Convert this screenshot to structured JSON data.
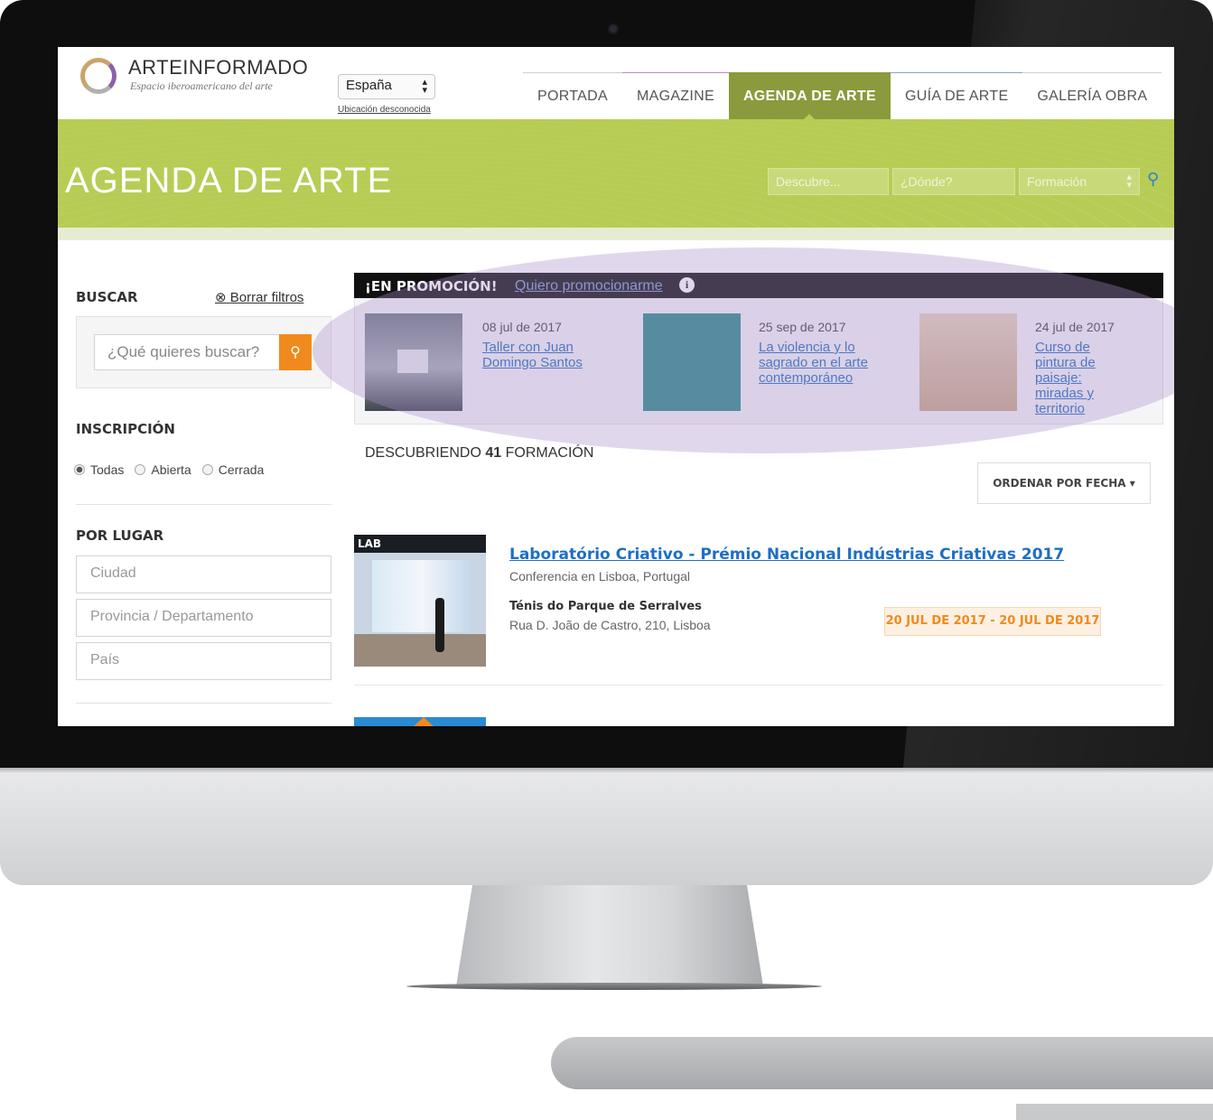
{
  "brand": {
    "name": "ARTEINFORMADO",
    "tagline": "Espacio iberoamericano del arte"
  },
  "location": {
    "country": "España",
    "status_link": "Ubicación desconocida"
  },
  "nav": {
    "items": [
      "PORTADA",
      "MAGAZINE",
      "AGENDA DE ARTE",
      "GUÍA DE ARTE",
      "GALERÍA OBRA"
    ],
    "active": "AGENDA DE ARTE"
  },
  "hero": {
    "title": "AGENDA DE ARTE",
    "discover_placeholder": "Descubre...",
    "where_placeholder": "¿Dónde?",
    "category_value": "Formación"
  },
  "sidebar": {
    "search_heading": "BUSCAR",
    "clear_filters": "Borrar filtros",
    "search_placeholder": "¿Qué quieres buscar?",
    "inscription_heading": "INSCRIPCIÓN",
    "inscription_options": [
      "Todas",
      "Abierta",
      "Cerrada"
    ],
    "inscription_selected": "Todas",
    "place_heading": "POR LUGAR",
    "city_placeholder": "Ciudad",
    "province_placeholder": "Provincia / Departamento",
    "country_placeholder": "País"
  },
  "promo": {
    "title": "¡EN PROMOCIÓN!",
    "link": "Quiero promocionarme",
    "items": [
      {
        "date": "08 jul de 2017",
        "title": "Taller con Juan Domingo Santos"
      },
      {
        "date": "25 sep de 2017",
        "title": "La violencia y lo sagrado en el arte contemporáneo"
      },
      {
        "date": "24 jul de 2017",
        "title": "Curso de pintura de paisaje: miradas y territorio"
      }
    ]
  },
  "results": {
    "prefix": "DESCUBRIENDO",
    "count": "41",
    "suffix": "FORMACIÓN",
    "sort_label": "ORDENAR POR FECHA"
  },
  "event": {
    "image_label": "LAB",
    "title": "Laboratório Criativo - Prémio Nacional Indústrias Criativas 2017",
    "subtitle": "Conferencia en Lisboa, Portugal",
    "venue": "Ténis do Parque de Serralves",
    "address": "Rua D. João de Castro, 210, Lisboa",
    "dates": "20 JUL DE 2017 - 20 JUL DE 2017"
  },
  "colors": {
    "hero_green": "#b6cc54",
    "nav_active": "#8a9a3c",
    "accent_orange": "#f08a1c",
    "link_blue": "#1d6fc4",
    "highlight_purple": "#aa8cc8"
  }
}
